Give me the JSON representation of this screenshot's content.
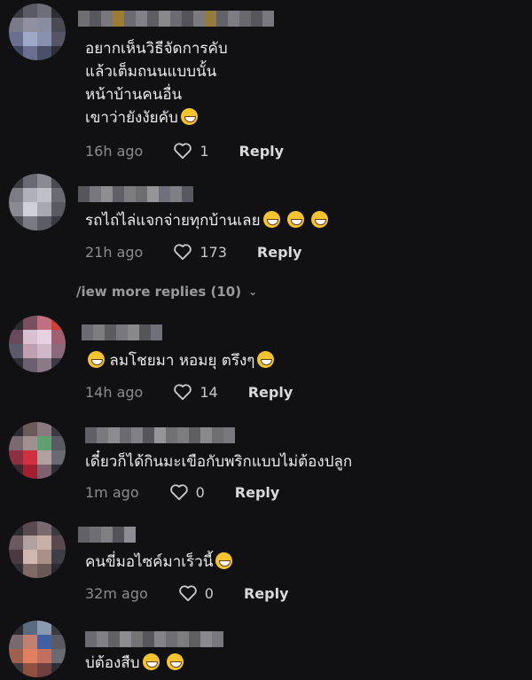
{
  "comments": [
    {
      "text": "อยากเห็นวิธีจัดการคับ\nแล้วเต็มถนนแบบนั้น\nหน้าบ้านคนอื่น\nเขาว่ายังงัยคับ",
      "emoji_after": "grin-icon",
      "time": "16h ago",
      "likes": "1",
      "reply_label": "Reply",
      "avatar_colors": [
        "#3a3a44",
        "#5a5a66",
        "#6e6e78",
        "#2d2d35",
        "#7a7a88",
        "#9090a0",
        "#8a8ca0",
        "#4a4a55",
        "#6a6f90",
        "#a0a8c8",
        "#8890b0",
        "#555566",
        "#3e4560",
        "#6b7090",
        "#4a4f6a",
        "#2f2f3a"
      ],
      "name_colors": [
        "#8d8d93",
        "#6f6f75",
        "#9a9aa0",
        "#c8a040",
        "#8a8a90",
        "#a7a7ad",
        "#77777d",
        "#b0b0b6",
        "#8a8a90",
        "#6a6a70",
        "#9d9da3",
        "#c0a050",
        "#7c7c82",
        "#a2a2a8",
        "#85858b",
        "#6e6e74",
        "#9b9ba1"
      ]
    },
    {
      "text": "รถไถ่ไล่แจกจ่ายทุกบ้านเลย",
      "emoji_after": "laugh-icon",
      "time": "21h ago",
      "likes": "173",
      "reply_label": "Reply",
      "avatar_colors": [
        "#3a3a40",
        "#6a6a72",
        "#8a8a92",
        "#4a4a50",
        "#7c7c84",
        "#b0b0b8",
        "#c0c0c8",
        "#6a6a72",
        "#8a8a90",
        "#d0d0d8",
        "#a8a8b0",
        "#5a5a62",
        "#4a4a52",
        "#7a7a82",
        "#5c5c64",
        "#3a3a42"
      ],
      "name_colors": [
        "#6c6c72",
        "#9a9aa0",
        "#b8b8be",
        "#7a7a80",
        "#a0a0a6",
        "#8c8c92",
        "#c0c0c6",
        "#9090a0",
        "#a4a4aa",
        "#70707a"
      ]
    },
    {
      "text": "ลมโชยมา หอมยุ ตรึงๆ",
      "emoji_before": "laugh-icon",
      "emoji_after": "grin-icon",
      "time": "14h ago",
      "likes": "14",
      "reply_label": "Reply",
      "avatar_colors": [
        "#2a2a30",
        "#7a5060",
        "#c07080",
        "#d04030",
        "#6a4a5a",
        "#d8c0d0",
        "#e8d0e0",
        "#a06070",
        "#5a5a6a",
        "#c0a0b0",
        "#d0b8c8",
        "#8a6a7a",
        "#2e2e36",
        "#6a6070",
        "#8a7a88",
        "#3a3a44"
      ],
      "name_colors": [
        "#8a8a90",
        "#a0a0a6",
        "#74747a",
        "#9a9aa0",
        "#b0b0b6",
        "#6c6c72",
        "#90909a"
      ]
    },
    {
      "text": "เดี๋ยวก็ได้กินมะเขือกับพริกแบบไม่ต้องปลูก",
      "time": "1m ago",
      "likes": "0",
      "reply_label": "Reply",
      "avatar_colors": [
        "#2a2a30",
        "#6a5a5a",
        "#8a7a80",
        "#3a3a40",
        "#7a6a70",
        "#a09090",
        "#60a070",
        "#5a5a62",
        "#8a3040",
        "#d03040",
        "#b0a0a0",
        "#6a6a72",
        "#3a2a30",
        "#a02030",
        "#806070",
        "#2e2e36"
      ],
      "name_colors": [
        "#7a7a80",
        "#9c9ca2",
        "#b4b4ba",
        "#8a8a90",
        "#a6a6ac",
        "#6e6e74",
        "#c0c0c6",
        "#909096",
        "#a0a0a6",
        "#78787e",
        "#b0b0b6",
        "#8c8c92",
        "#9a9aa0"
      ]
    },
    {
      "text": "คนขี่มอไซค์มาเร็วนี้",
      "emoji_after": "laugh-icon",
      "time": "32m ago",
      "likes": "0",
      "reply_label": "Reply",
      "avatar_colors": [
        "#2a2a30",
        "#5a4a50",
        "#7a6a70",
        "#3a3a40",
        "#6a5a60",
        "#b0a0a0",
        "#c8b0a8",
        "#5a4a50",
        "#4a3a40",
        "#d0b8b0",
        "#a89088",
        "#3e3e46",
        "#2e2e34",
        "#806a66",
        "#6a5856",
        "#2a2a30"
      ],
      "name_colors": [
        "#7c7c82",
        "#8e8e94",
        "#a4a4aa",
        "#6a6a70",
        "#b6b6bc"
      ]
    },
    {
      "text": "บ่ต้องสืบ",
      "emoji_after": "laugh-icon",
      "emoji_after2": "laugh-icon",
      "time": "",
      "likes": "",
      "reply_label": "",
      "avatar_colors": [
        "#2a2a30",
        "#5a6a80",
        "#8a9ab0",
        "#3a3a40",
        "#7a6a70",
        "#c08070",
        "#4060a0",
        "#5a5a62",
        "#a06050",
        "#e08060",
        "#c07060",
        "#6a6a72",
        "#3a3a40",
        "#905040",
        "#704040",
        "#2e2e36"
      ],
      "name_colors": [
        "#8a8a90",
        "#a6a6ac",
        "#7c7c82",
        "#b4b4ba",
        "#969696",
        "#6e6e74",
        "#aaaab0",
        "#8c8c92",
        "#a0a0a6",
        "#78787e",
        "#b2b2b8",
        "#9a9aa0"
      ]
    }
  ],
  "view_more": {
    "label": "/iew more replies (10)",
    "chevron": "chevron-down-icon"
  },
  "colors": {
    "background": "#111114",
    "time_text": "#8c8c90",
    "reply_text": "#d9d9db"
  }
}
